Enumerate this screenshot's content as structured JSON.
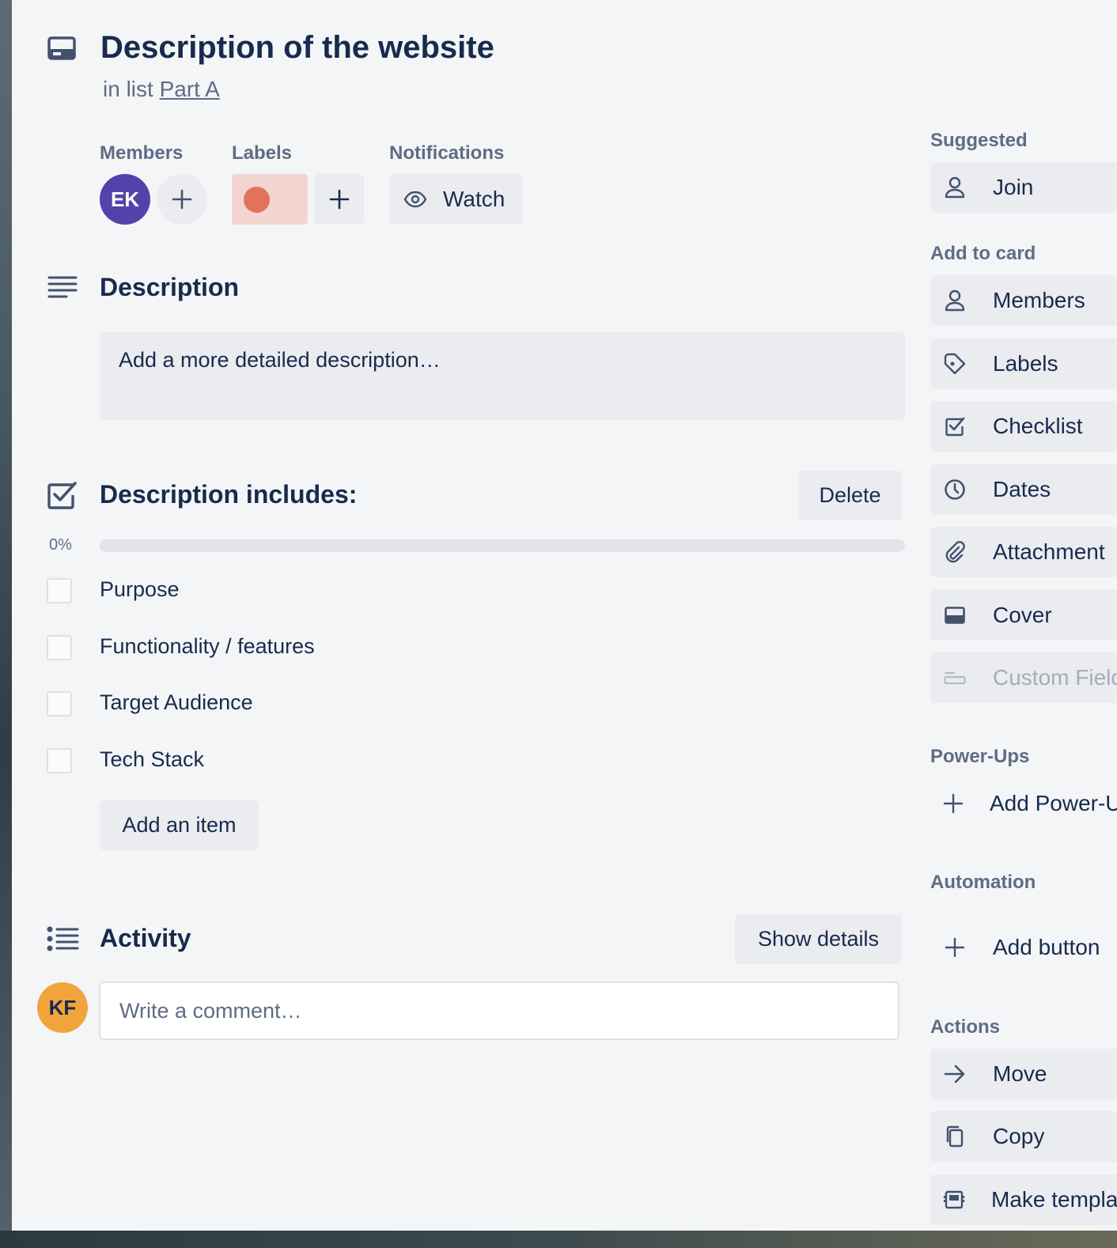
{
  "card": {
    "title": "Description of the website",
    "in_list_prefix": "in list",
    "list_name": "Part A"
  },
  "members": {
    "label": "Members",
    "avatar_initials": "EK",
    "avatar_color": "#5243aa"
  },
  "labels": {
    "label": "Labels",
    "chip_color": "#e2725b"
  },
  "notifications": {
    "label": "Notifications",
    "watch_label": "Watch"
  },
  "description": {
    "heading": "Description",
    "placeholder": "Add a more detailed description…"
  },
  "checklist": {
    "heading": "Description includes:",
    "delete_label": "Delete",
    "progress_text": "0%",
    "progress_fraction": 0,
    "items": [
      {
        "text": "Purpose",
        "checked": false
      },
      {
        "text": "Functionality / features",
        "checked": false
      },
      {
        "text": "Target Audience",
        "checked": false
      },
      {
        "text": "Tech Stack",
        "checked": false
      }
    ],
    "add_item_label": "Add an item"
  },
  "activity": {
    "heading": "Activity",
    "show_details_label": "Show details",
    "comment_placeholder": "Write a comment…",
    "user_initials": "KF",
    "user_color": "#f2a43c"
  },
  "sidebar": {
    "suggested_label": "Suggested",
    "join_label": "Join",
    "add_to_card_label": "Add to card",
    "add_to_card": [
      "Members",
      "Labels",
      "Checklist",
      "Dates",
      "Attachment",
      "Cover",
      "Custom Fields"
    ],
    "powerups_label": "Power-Ups",
    "add_powerups_label": "Add Power-Ups",
    "automation_label": "Automation",
    "add_button_label": "Add button",
    "actions_label": "Actions",
    "actions": [
      "Move",
      "Copy",
      "Make template"
    ]
  }
}
